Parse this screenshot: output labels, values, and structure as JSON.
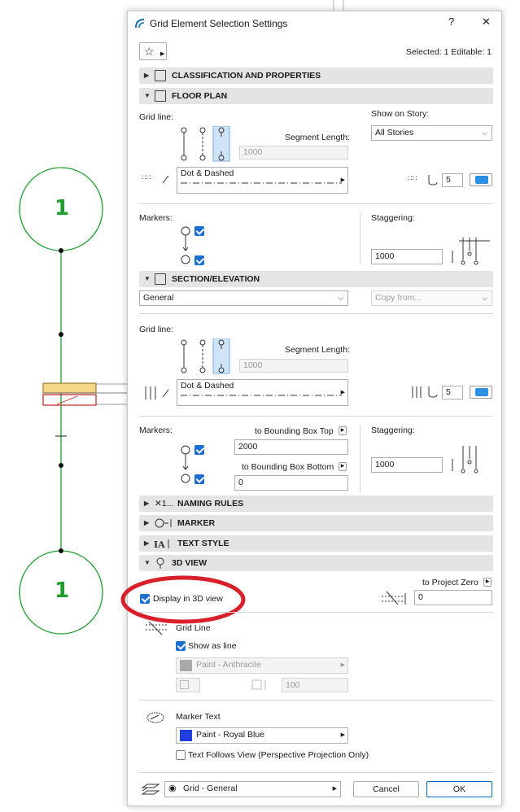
{
  "dialog": {
    "title": "Grid Element Selection Settings",
    "help_label": "?",
    "close_label": "✕",
    "selected_info": "Selected: 1 Editable: 1"
  },
  "sections": {
    "classification": "CLASSIFICATION AND PROPERTIES",
    "floor_plan": "FLOOR PLAN",
    "section_elevation": "SECTION/ELEVATION",
    "naming_rules": "NAMING RULES",
    "marker": "MARKER",
    "text_style": "TEXT STYLE",
    "view_3d": "3D VIEW"
  },
  "floor_plan": {
    "grid_line_label": "Grid line:",
    "segment_length_label": "Segment Length:",
    "segment_length_value": "1000",
    "show_on_story_label": "Show on Story:",
    "show_on_story_value": "All Stories",
    "line_type_name": "Dot & Dashed",
    "pen_value": "5",
    "markers_label": "Markers:",
    "staggering_label": "Staggering:",
    "staggering_value": "1000"
  },
  "section_elevation": {
    "view_select": "General",
    "copy_from": "Copy from...",
    "grid_line_label": "Grid line:",
    "segment_length_label": "Segment Length:",
    "segment_length_value": "1000",
    "line_type_name": "Dot & Dashed",
    "pen_value": "5",
    "markers_label": "Markers:",
    "bbox_top_label": "to Bounding Box Top",
    "bbox_top_value": "2000",
    "bbox_bottom_label": "to Bounding Box Bottom",
    "bbox_bottom_value": "0",
    "staggering_label": "Staggering:",
    "staggering_value": "1000"
  },
  "naming_rules_prefix": "✕1...",
  "view_3d": {
    "display_label": "Display in 3D view",
    "to_project_zero_label": "to Project Zero",
    "to_project_zero_value": "0",
    "grid_line_label": "Grid Line",
    "show_as_line_label": "Show as line",
    "surface_value": "Paint - Anthracite",
    "thickness_value": "100",
    "marker_text_label": "Marker Text",
    "marker_surface_value": "Paint - Royal Blue",
    "text_follows_label": "Text Follows View (Perspective Projection Only)"
  },
  "footer": {
    "favorite_value": "Grid - General",
    "cancel_label": "Cancel",
    "ok_label": "OK"
  },
  "canvas": {
    "bubble_label_top": "1",
    "bubble_label_bottom": "1"
  },
  "colors": {
    "grid_green": "#1e9e2e",
    "checkbox_blue": "#1a6fd0",
    "highlight_red": "#d8202a",
    "royal_blue": "#1d3fe0",
    "anthracite": "#a9a9a9"
  }
}
